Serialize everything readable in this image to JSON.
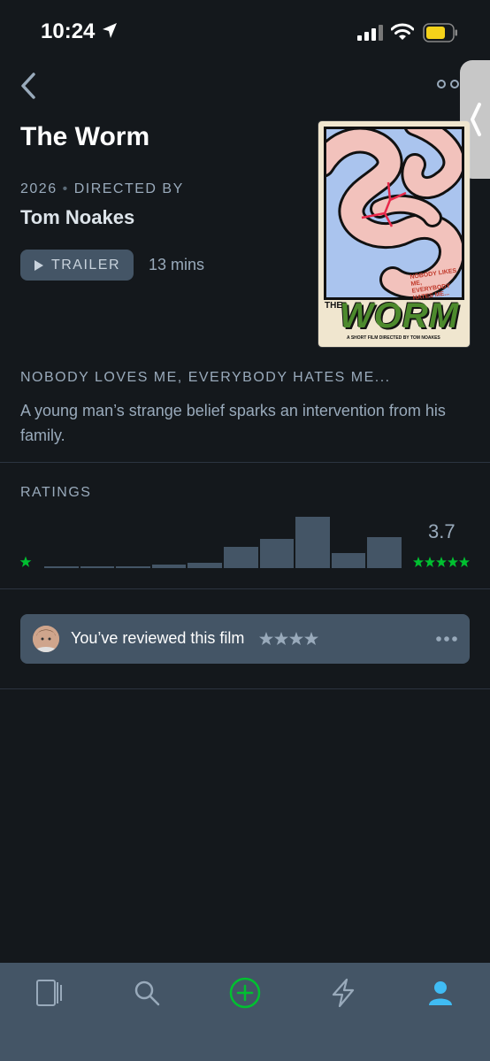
{
  "status": {
    "time": "10:24"
  },
  "film": {
    "title": "The Worm",
    "year": "2026",
    "directed_by_label": "DIRECTED BY",
    "director": "Tom Noakes",
    "trailer_label": "TRAILER",
    "runtime": "13 mins",
    "tagline": "NOBODY LOVES ME, EVERYBODY HATES ME...",
    "synopsis": "A young man’s strange belief sparks an intervention from his family."
  },
  "poster": {
    "tagline_line1": "NOBODY LIKES ME,",
    "tagline_line2": "EVERYBODY HATES ME...",
    "the": "THE",
    "worm": "WORM",
    "credit": "A SHORT FILM DIRECTED BY TOM NOAKES"
  },
  "ratings": {
    "label": "RATINGS",
    "average": "3.7",
    "histogram": [
      0.02,
      0.02,
      0.02,
      0.07,
      0.1,
      0.42,
      0.57,
      1.0,
      0.3,
      0.6
    ]
  },
  "review": {
    "text": "You’ve reviewed this film",
    "stars": 4
  },
  "colors": {
    "background": "#14181c",
    "accent_green": "#00c030",
    "bar": "#445566",
    "muted_text": "#99aabb",
    "profile_blue": "#40bcf4"
  },
  "tabs": [
    {
      "icon": "films-icon"
    },
    {
      "icon": "search-icon"
    },
    {
      "icon": "add-icon"
    },
    {
      "icon": "activity-icon"
    },
    {
      "icon": "profile-icon"
    }
  ]
}
